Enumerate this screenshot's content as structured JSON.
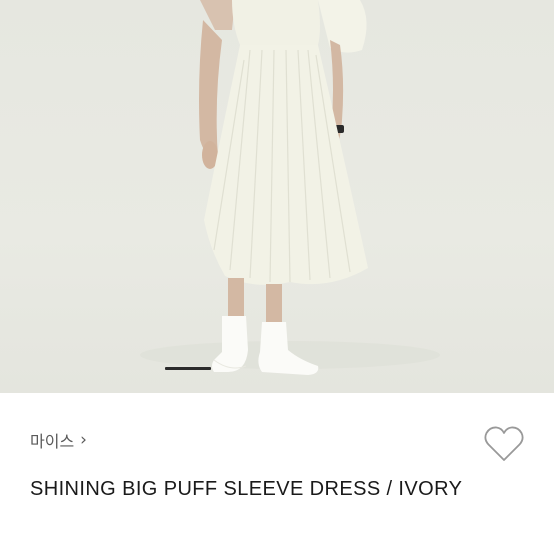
{
  "product": {
    "brand": "마이스",
    "brand_chevron": "›",
    "title": "SHINING BIG PUFF SLEEVE DRESS / IVORY"
  },
  "icons": {
    "like": "heart-outline-icon",
    "brand_link": "chevron-right-icon"
  },
  "carousel": {
    "current_index": 1
  },
  "colors": {
    "background": "#ffffff",
    "image_bg": "#e7e8e1",
    "dress": "#f2f2e6",
    "text_primary": "#1a1a1a",
    "text_secondary": "#5a5a5a",
    "icon": "#999999"
  }
}
